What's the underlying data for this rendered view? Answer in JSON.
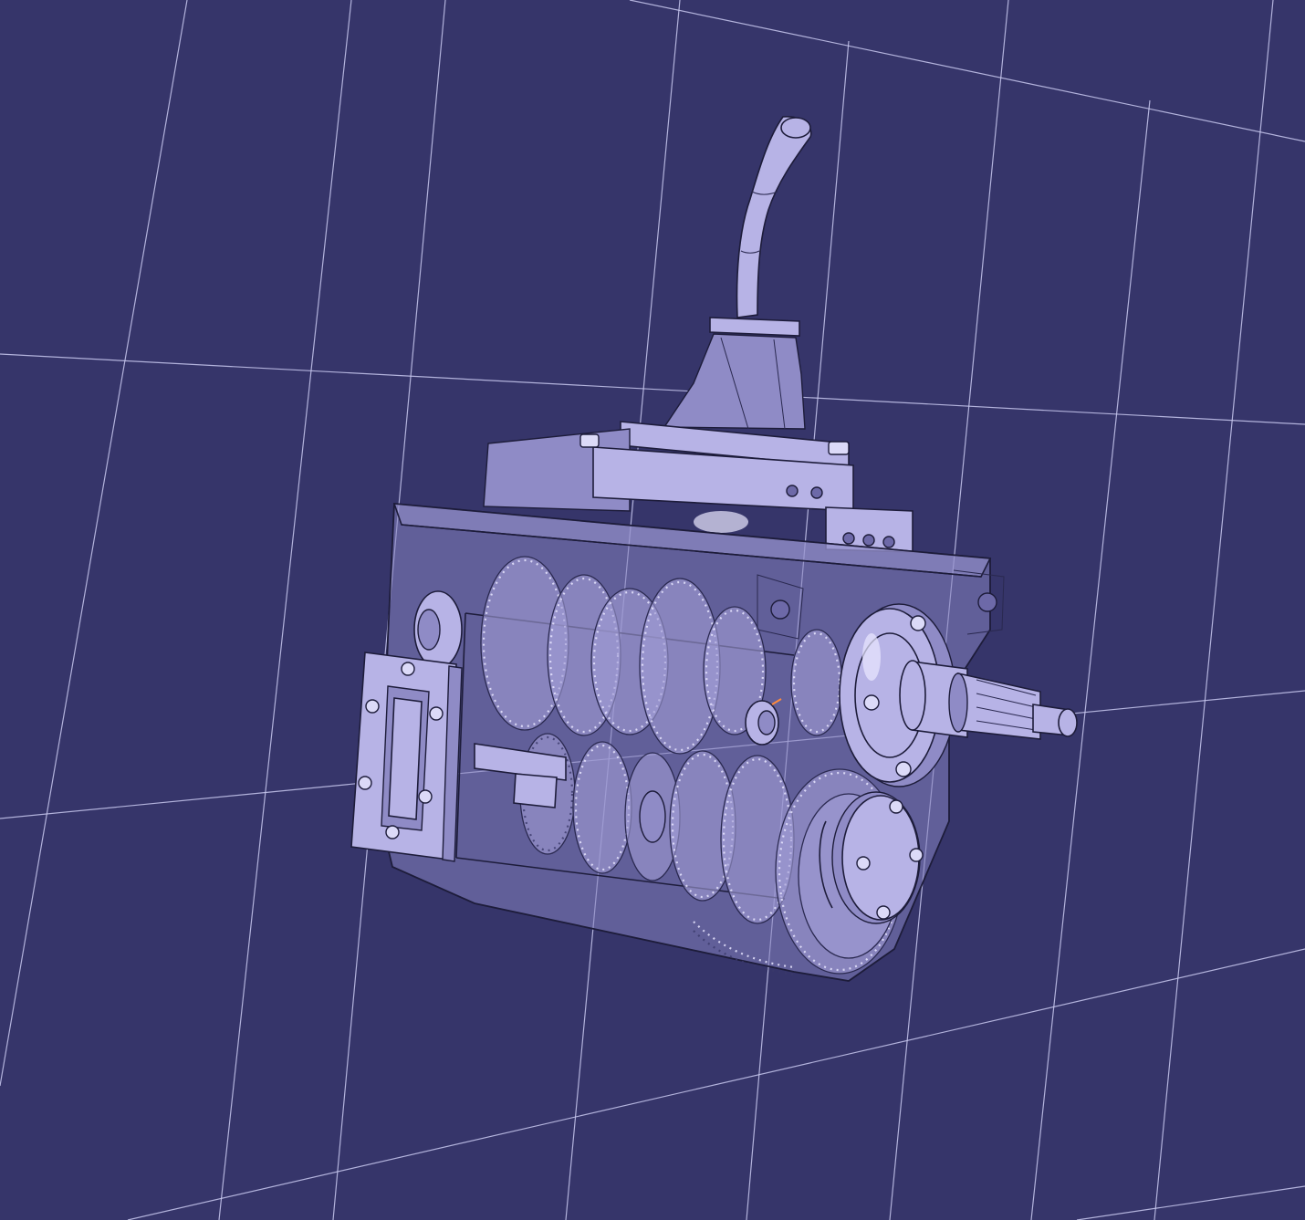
{
  "viewer": {
    "background_color": "#36356a",
    "grid_color": "#c9c9f0",
    "part_color": "#b7b3e6",
    "edge_color": "#1d1c3a"
  },
  "model": {
    "icon": "gearbox-assembly-icon",
    "components": [
      "gear-lever",
      "shift-tower",
      "top-cover",
      "transparent-housing",
      "gear-train",
      "output-shaft",
      "output-flange",
      "bearing-cap",
      "side-inspection-cover"
    ]
  }
}
